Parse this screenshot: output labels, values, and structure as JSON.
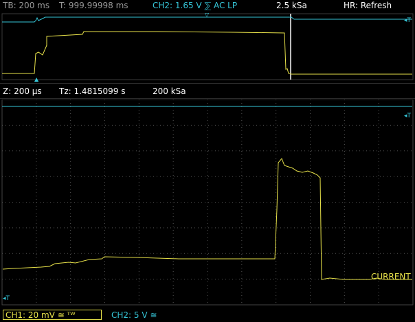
{
  "top_bar": {
    "tb": "TB: 200 ms",
    "t": "T: 999.99998 ms",
    "ch2_trigger": "CH2: 1.65 V ⅀ AC LP",
    "sample_rate": "2.5 kSa",
    "hr_mode": "HR: Refresh"
  },
  "zoom_bar": {
    "z": "Z: 200 µs",
    "tz": "Tz: 1.4815099 s",
    "sample_rate": "200 kSa"
  },
  "trace_label": "CURRENT",
  "markers": {
    "top_right_trigger": "◂T",
    "main_right_trigger": "◂T",
    "bottom_left_trigger": "◂T"
  },
  "bottom_bar": {
    "ch1": "CH1: 20 mV ≅ ᵀᵂ",
    "ch2": "CH2: 5 V ≅"
  },
  "colors": {
    "ch1": "#e8e24a",
    "ch2": "#36c6d8",
    "grid": "#555555",
    "background": "#000000"
  }
}
